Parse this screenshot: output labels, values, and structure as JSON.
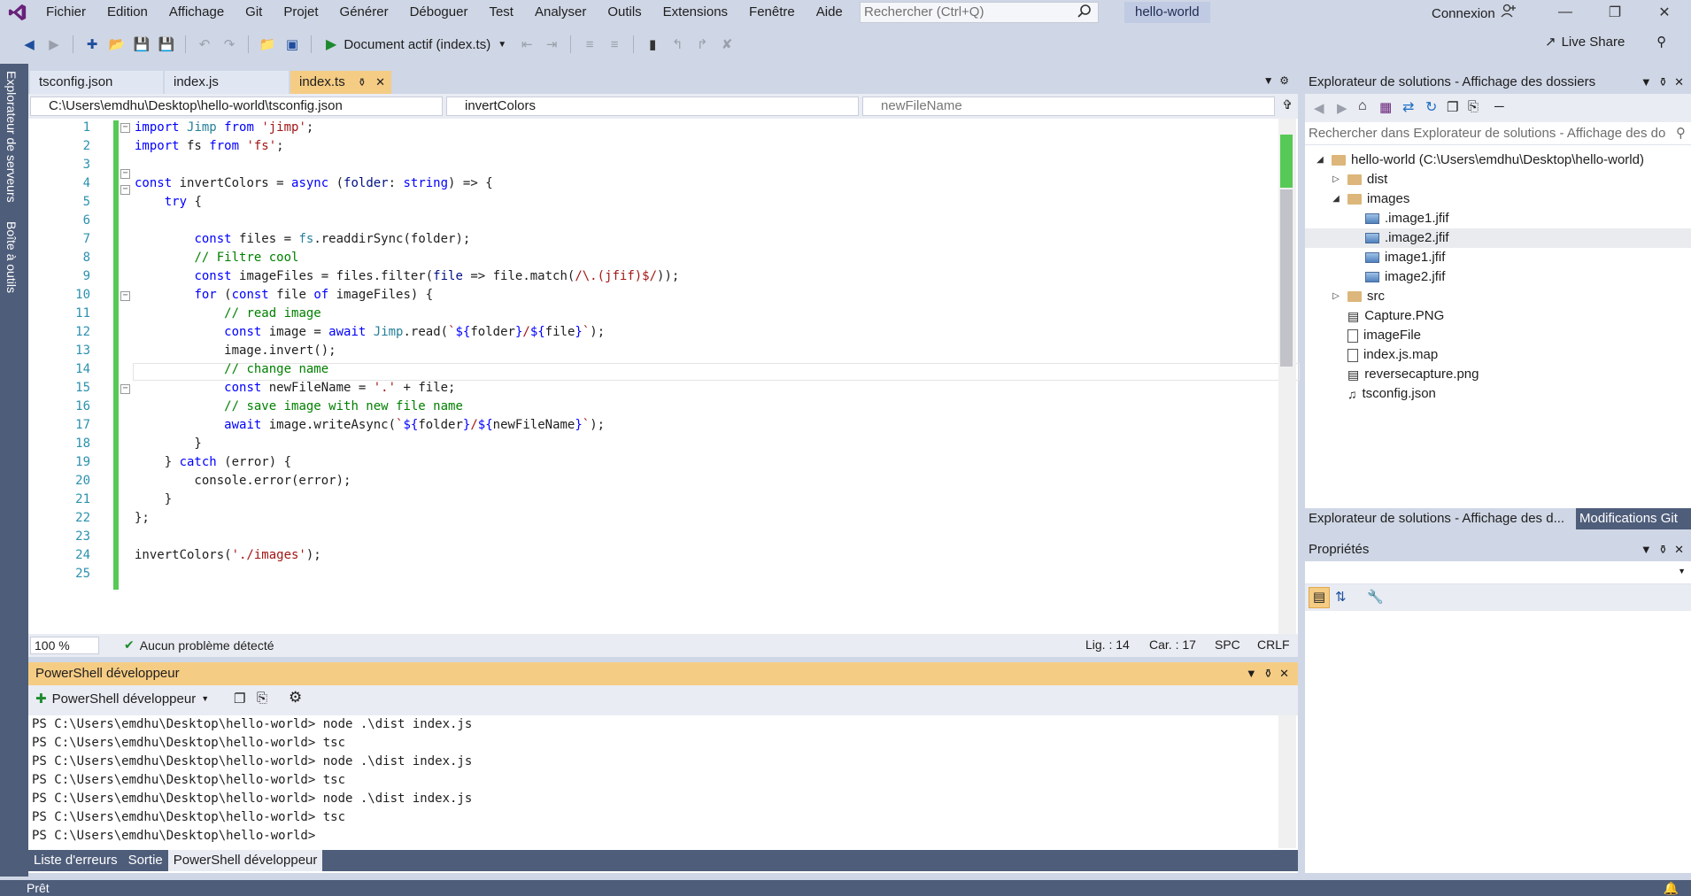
{
  "menu": {
    "items": [
      "Fichier",
      "Edition",
      "Affichage",
      "Git",
      "Projet",
      "Générer",
      "Déboguer",
      "Test",
      "Analyser",
      "Outils",
      "Extensions",
      "Fenêtre",
      "Aide"
    ],
    "search_placeholder": "Rechercher (Ctrl+Q)",
    "solution_name": "hello-world",
    "sign_in": "Connexion"
  },
  "toolbar": {
    "run_label": "Document actif (index.ts)",
    "live_share": "Live Share"
  },
  "left_strip": {
    "server_explorer": "Explorateur de serveurs",
    "toolbox": "Boîte à outils"
  },
  "editor": {
    "tabs": [
      {
        "label": "tsconfig.json"
      },
      {
        "label": "index.js"
      },
      {
        "label": "index.ts"
      }
    ],
    "nav": {
      "file_path": "C:\\Users\\emdhu\\Desktop\\hello-world\\tsconfig.json",
      "member": "invertColors",
      "symbol": "newFileName"
    },
    "line_numbers": [
      "1",
      "2",
      "3",
      "4",
      "5",
      "6",
      "7",
      "8",
      "9",
      "10",
      "11",
      "12",
      "13",
      "14",
      "15",
      "16",
      "17",
      "18",
      "19",
      "20",
      "21",
      "22",
      "23",
      "24",
      "25"
    ],
    "status": {
      "zoom": "100 %",
      "issues": "Aucun problème détecté",
      "line": "Lig. : 14",
      "char": "Car. : 17",
      "spacing": "SPC",
      "eol": "CRLF"
    }
  },
  "terminal": {
    "title": "PowerShell développeur",
    "new_button": "PowerShell développeur",
    "lines": [
      "PS C:\\Users\\emdhu\\Desktop\\hello-world> node .\\dist index.js",
      "PS C:\\Users\\emdhu\\Desktop\\hello-world> tsc",
      "PS C:\\Users\\emdhu\\Desktop\\hello-world> node .\\dist index.js",
      "PS C:\\Users\\emdhu\\Desktop\\hello-world> tsc",
      "PS C:\\Users\\emdhu\\Desktop\\hello-world> node .\\dist index.js",
      "PS C:\\Users\\emdhu\\Desktop\\hello-world> tsc",
      "PS C:\\Users\\emdhu\\Desktop\\hello-world>"
    ]
  },
  "bottom_tabs": [
    "Liste d'erreurs",
    "Sortie",
    "PowerShell développeur"
  ],
  "solution_explorer": {
    "title": "Explorateur de solutions - Affichage des dossiers",
    "search_placeholder": "Rechercher dans Explorateur de solutions - Affichage des do",
    "root": "hello-world (C:\\Users\\emdhu\\Desktop\\hello-world)",
    "items": [
      {
        "label": "dist",
        "kind": "folder"
      },
      {
        "label": "images",
        "kind": "folder"
      },
      {
        "label": ".image1.jfif",
        "kind": "image"
      },
      {
        "label": ".image2.jfif",
        "kind": "image"
      },
      {
        "label": "image1.jfif",
        "kind": "image"
      },
      {
        "label": "image2.jfif",
        "kind": "image"
      },
      {
        "label": "src",
        "kind": "folder"
      },
      {
        "label": "Capture.PNG",
        "kind": "png"
      },
      {
        "label": "imageFile",
        "kind": "file"
      },
      {
        "label": "index.js.map",
        "kind": "file"
      },
      {
        "label": "reversecapture.png",
        "kind": "png"
      },
      {
        "label": "tsconfig.json",
        "kind": "json"
      }
    ],
    "tabs": [
      "Explorateur de solutions - Affichage des d...",
      "Modifications Git"
    ]
  },
  "properties": {
    "title": "Propriétés"
  },
  "statusbar": {
    "text": "Prêt"
  },
  "colors": {
    "chrome": "#cfd6e5",
    "active_tab": "#f5cc84",
    "dark_strip": "#4e5d7a",
    "change_bar": "#57c957"
  }
}
